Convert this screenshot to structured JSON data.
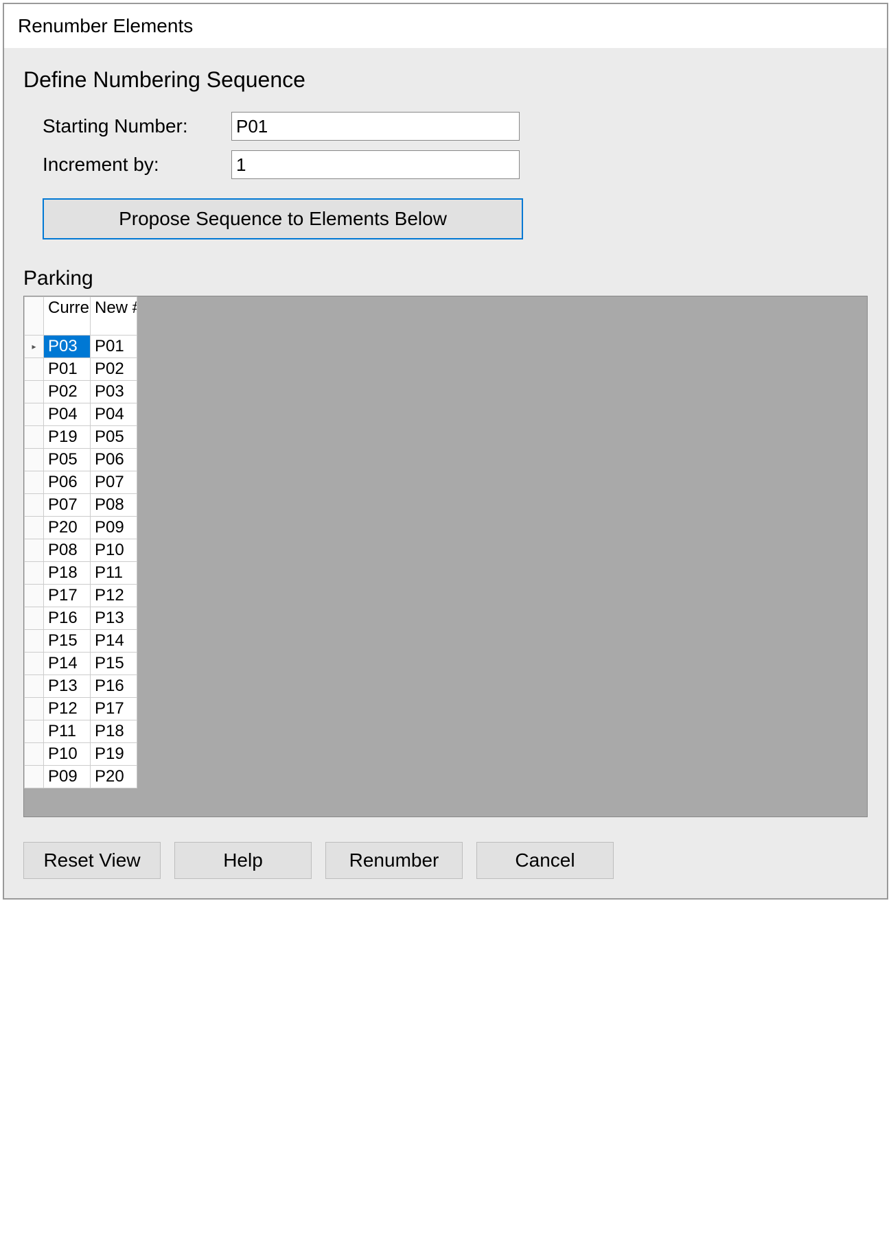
{
  "window": {
    "title": "Renumber Elements"
  },
  "section": {
    "heading": "Define Numbering Sequence"
  },
  "form": {
    "starting_label": "Starting Number:",
    "starting_value": "P01",
    "increment_label": "Increment by:",
    "increment_value": "1"
  },
  "propose_button": "Propose Sequence to Elements Below",
  "table": {
    "heading": "Parking",
    "col_current": "Current #",
    "col_new": "New #",
    "rows": [
      {
        "current": "P03",
        "new": "P01",
        "selected": true,
        "marker": "▸"
      },
      {
        "current": "P01",
        "new": "P02"
      },
      {
        "current": "P02",
        "new": "P03"
      },
      {
        "current": "P04",
        "new": "P04"
      },
      {
        "current": "P19",
        "new": "P05"
      },
      {
        "current": "P05",
        "new": "P06"
      },
      {
        "current": "P06",
        "new": "P07"
      },
      {
        "current": "P07",
        "new": "P08"
      },
      {
        "current": "P20",
        "new": "P09"
      },
      {
        "current": "P08",
        "new": "P10"
      },
      {
        "current": "P18",
        "new": "P11"
      },
      {
        "current": "P17",
        "new": "P12"
      },
      {
        "current": "P16",
        "new": "P13"
      },
      {
        "current": "P15",
        "new": "P14"
      },
      {
        "current": "P14",
        "new": "P15"
      },
      {
        "current": "P13",
        "new": "P16"
      },
      {
        "current": "P12",
        "new": "P17"
      },
      {
        "current": "P11",
        "new": "P18"
      },
      {
        "current": "P10",
        "new": "P19"
      },
      {
        "current": "P09",
        "new": "P20"
      }
    ]
  },
  "buttons": {
    "reset": "Reset View",
    "help": "Help",
    "renumber": "Renumber",
    "cancel": "Cancel"
  }
}
